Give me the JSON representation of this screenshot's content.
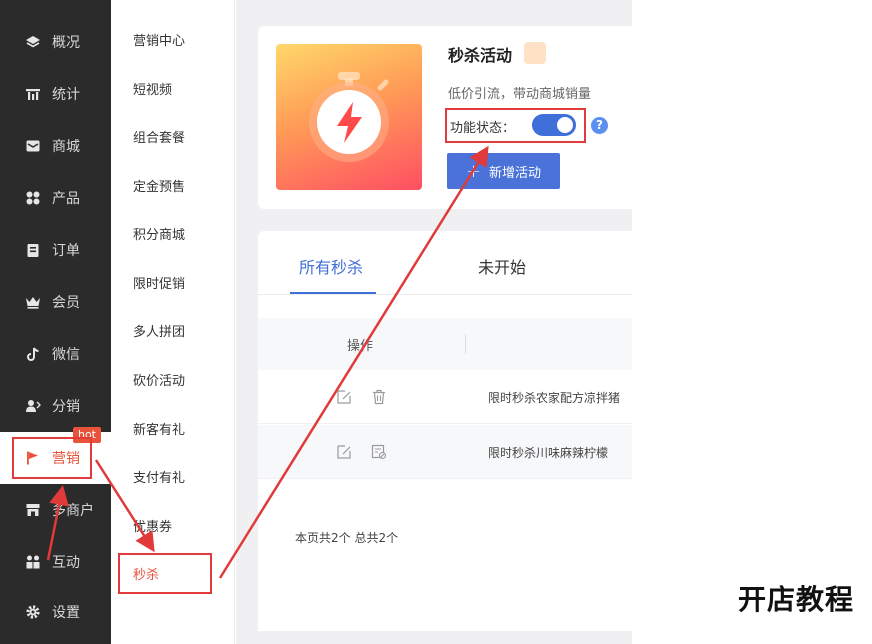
{
  "nav": {
    "items": [
      {
        "label": "概况",
        "icon": "layers-icon"
      },
      {
        "label": "统计",
        "icon": "chart-icon"
      },
      {
        "label": "商城",
        "icon": "mail-icon"
      },
      {
        "label": "产品",
        "icon": "grid-icon"
      },
      {
        "label": "订单",
        "icon": "clipboard-icon"
      },
      {
        "label": "会员",
        "icon": "crown-icon"
      },
      {
        "label": "微信",
        "icon": "tiktok-icon"
      },
      {
        "label": "分销",
        "icon": "user-share-icon"
      },
      {
        "label": "营销",
        "icon": "flag-icon"
      },
      {
        "label": "多商户",
        "icon": "store-icon"
      },
      {
        "label": "互动",
        "icon": "users-icon"
      },
      {
        "label": "设置",
        "icon": "gear-icon"
      }
    ],
    "hot_badge": "hot",
    "accent": "#e8533a"
  },
  "submenu": {
    "items": [
      "营销中心",
      "短视频",
      "组合套餐",
      "定金预售",
      "积分商城",
      "限时促销",
      "多人拼团",
      "砍价活动",
      "新客有礼",
      "支付有礼",
      "优惠券",
      "秒杀"
    ]
  },
  "promo": {
    "title": "秒杀活动",
    "desc": "低价引流，带动商城销量",
    "status_label": "功能状态：",
    "status_on": true,
    "help": "?",
    "add_button": "新增活动"
  },
  "list": {
    "tabs": [
      "所有秒杀",
      "未开始"
    ],
    "column_actions": "操作",
    "rows": [
      {
        "name": "限时秒杀农家配方凉拌猪"
      },
      {
        "name": "限时秒杀川味麻辣柠檬"
      }
    ],
    "pager": "本页共2个  总共2个"
  },
  "watermark": "开店教程"
}
